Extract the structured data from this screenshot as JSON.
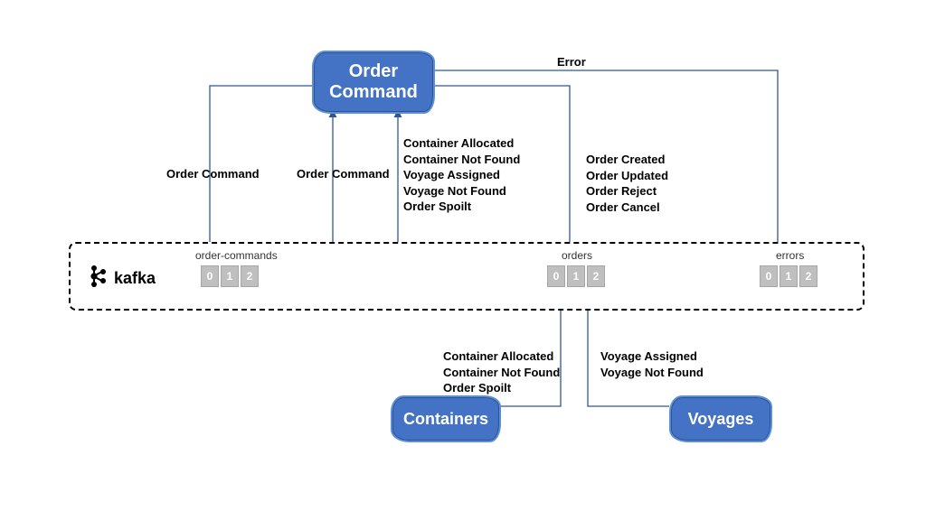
{
  "nodes": {
    "orderCommand": "Order\nCommand",
    "containers": "Containers",
    "voyages": "Voyages"
  },
  "kafka": {
    "label": "kafka",
    "topics": {
      "orderCommands": "order-commands",
      "orders": "orders",
      "errors": "errors"
    },
    "partitions": [
      "0",
      "1",
      "2"
    ]
  },
  "edges": {
    "orderCommand_to_orderCommands": "Order Command",
    "orderCommands_to_orderCommand": "Order Command",
    "orders_to_orderCommand": "Container Allocated\nContainer Not Found\nVoyage Assigned\nVoyage Not Found\nOrder Spoilt",
    "orderCommand_to_orders": "Order Created\nOrder Updated\nOrder Reject\nOrder Cancel",
    "orderCommand_to_errors": "Error",
    "containers_to_orders": "Container Allocated\nContainer Not Found\nOrder Spoilt",
    "voyages_to_orders": "Voyage Assigned\nVoyage Not Found"
  }
}
